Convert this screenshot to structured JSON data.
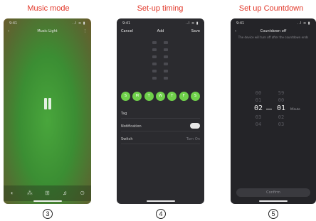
{
  "captions": {
    "music": "Music mode",
    "timing": "Set-up timing",
    "countdown": "Set up Countdown"
  },
  "step_numbers": [
    "3",
    "4",
    "5"
  ],
  "screens": {
    "music": {
      "status_time": "9:41",
      "status_signal": "..l ≋ ▮",
      "back_icon": "‹",
      "title": "Music Light",
      "menu_icon": "⋮",
      "tabs": [
        "◐",
        "⁂",
        "⊞",
        "♫",
        "⊙"
      ],
      "active_tab": 3,
      "colors": {
        "green": "#49a63c",
        "olive": "#6a5b2c"
      }
    },
    "timing": {
      "status_time": "9:41",
      "status_signal": "..l ≋ ▮",
      "cancel": "Cancel",
      "title": "Add",
      "save": "Save",
      "days": [
        "S",
        "M",
        "T",
        "W",
        "T",
        "F",
        "S"
      ],
      "rows": [
        {
          "label": "Tag",
          "value": ""
        },
        {
          "label": "Notification",
          "value": ""
        },
        {
          "label": "Switch",
          "value": "Turn On"
        }
      ],
      "accent": "#6fd04a"
    },
    "countdown": {
      "status_time": "9:41",
      "status_signal": "..l ≋ ▮",
      "back_icon": "‹",
      "title": "Countdown off",
      "subtitle": "The device will turn off after the countdown ends",
      "hours": [
        "00",
        "01",
        "02",
        "03",
        "04"
      ],
      "minutes": [
        "59",
        "00",
        "01",
        "02",
        "03"
      ],
      "selected_hour": "02",
      "selected_minute": "01",
      "unit": "Minute",
      "confirm": "Confirm"
    }
  }
}
